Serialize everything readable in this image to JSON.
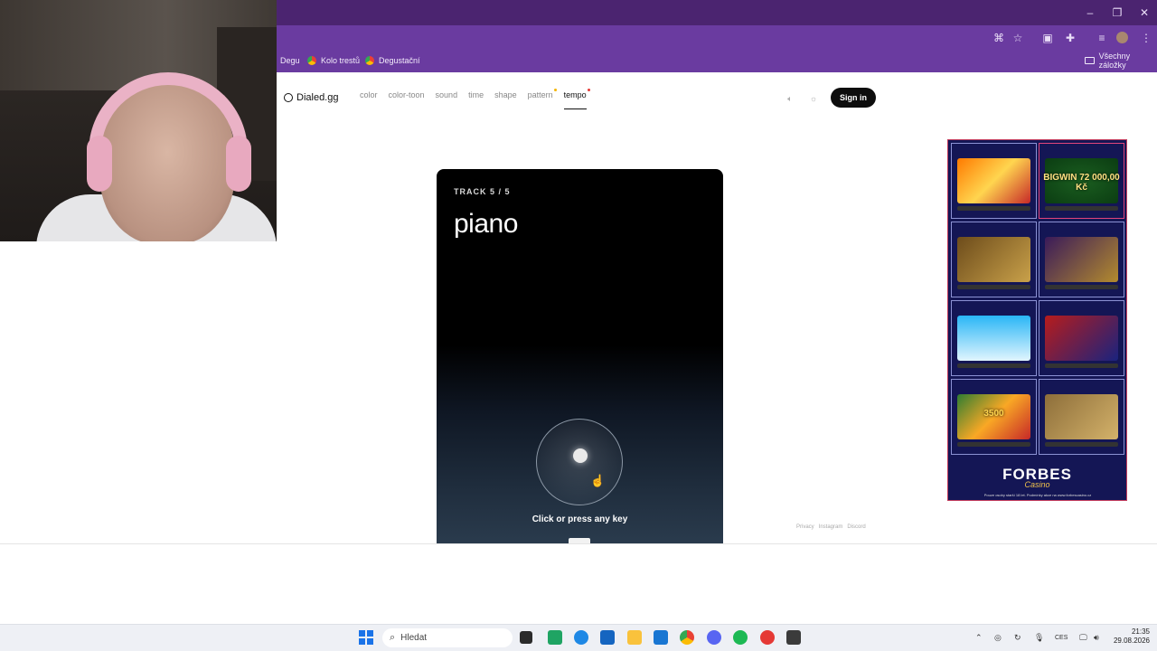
{
  "browser": {
    "bookmarks": [
      {
        "label": "Degu"
      },
      {
        "label": "Kolo trestů"
      },
      {
        "label": "Degustační"
      }
    ],
    "all_bookmarks_label": "Všechny záložky"
  },
  "site": {
    "logo": "Dialed.gg",
    "nav": [
      "color",
      "color-toon",
      "sound",
      "time",
      "shape",
      "pattern",
      "tempo"
    ],
    "active_nav": "tempo",
    "sign_in": "Sign in",
    "footer": [
      "Privacy",
      "Instagram",
      "Discord"
    ]
  },
  "game": {
    "track": "TRACK 5 / 5",
    "name": "piano",
    "hint": "Click or press any key"
  },
  "ad": {
    "slots": [
      "",
      "BIGWIN 72 000,00 Kč",
      "",
      "",
      "",
      "",
      "3500",
      ""
    ],
    "logo": "FORBES",
    "sub": "Casino",
    "fine": "Pouze osoby starší 18 let. Podmínky akce na www.forbescasino.cz"
  },
  "taskbar": {
    "search_placeholder": "Hledat",
    "lang": "CES",
    "time": "21:35",
    "date": "29.08.2026"
  }
}
